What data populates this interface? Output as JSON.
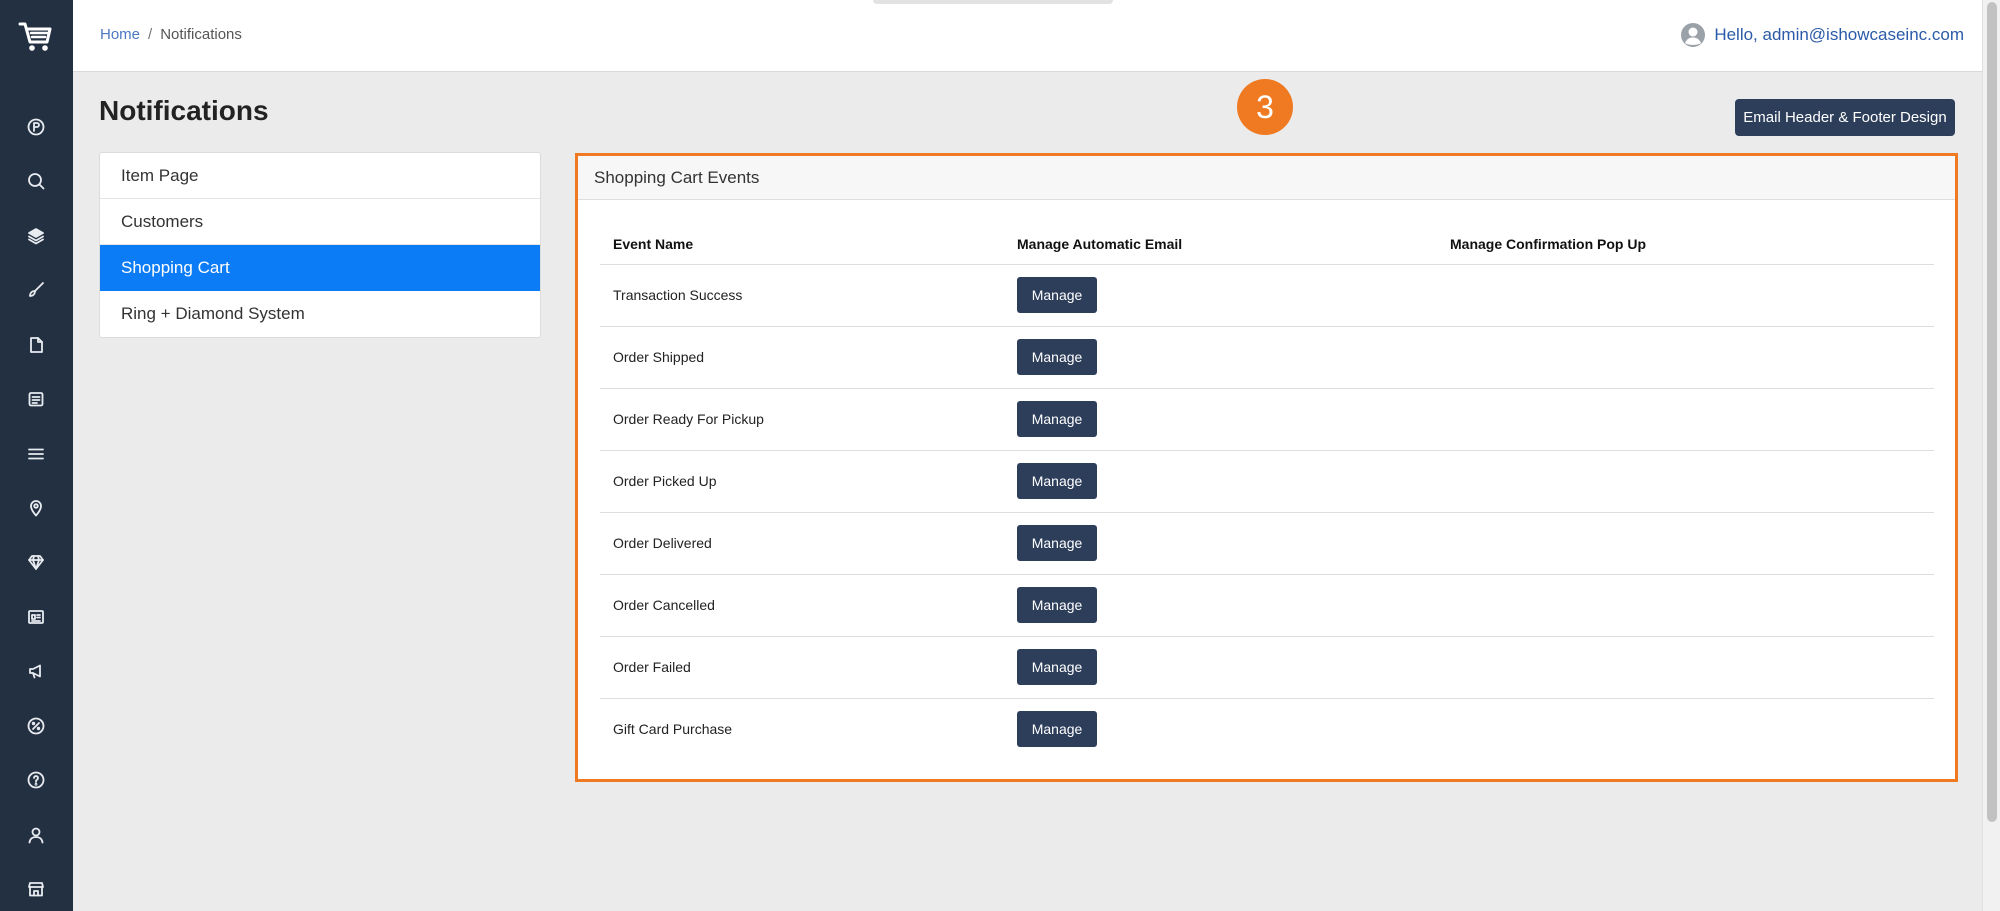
{
  "breadcrumb": {
    "home": "Home",
    "separator": "/",
    "current": "Notifications"
  },
  "user": {
    "greeting": "Hello, admin@ishowcaseinc.com",
    "icon": "user-circle-icon"
  },
  "page": {
    "title": "Notifications"
  },
  "step_badge": "3",
  "header_footer_button": "Email Header & Footer Design",
  "categories": [
    {
      "label": "Item Page",
      "active": false
    },
    {
      "label": "Customers",
      "active": false
    },
    {
      "label": "Shopping Cart",
      "active": true
    },
    {
      "label": "Ring + Diamond System",
      "active": false
    }
  ],
  "panel": {
    "title": "Shopping Cart Events",
    "columns": [
      "Event Name",
      "Manage Automatic Email",
      "Manage Confirmation Pop Up"
    ],
    "rows": [
      {
        "event": "Transaction Success",
        "email_action": "Manage",
        "popup_action": ""
      },
      {
        "event": "Order Shipped",
        "email_action": "Manage",
        "popup_action": ""
      },
      {
        "event": "Order Ready For Pickup",
        "email_action": "Manage",
        "popup_action": ""
      },
      {
        "event": "Order Picked Up",
        "email_action": "Manage",
        "popup_action": ""
      },
      {
        "event": "Order Delivered",
        "email_action": "Manage",
        "popup_action": ""
      },
      {
        "event": "Order Cancelled",
        "email_action": "Manage",
        "popup_action": ""
      },
      {
        "event": "Order Failed",
        "email_action": "Manage",
        "popup_action": ""
      },
      {
        "event": "Gift Card Purchase",
        "email_action": "Manage",
        "popup_action": ""
      }
    ]
  },
  "sidebar_icons": [
    "cart-logo-icon",
    "p-circle-icon",
    "seo-search-icon",
    "layers-icon",
    "brush-icon",
    "file-icon",
    "blog-icon",
    "menu-icon",
    "map-pin-icon",
    "diamond-icon",
    "gallery-icon",
    "megaphone-icon",
    "discount-icon",
    "help-icon",
    "user-icon",
    "store-icon"
  ],
  "colors": {
    "sidebar": "#233041",
    "accent": "#0b7cf5",
    "button": "#2d3e5b",
    "highlight": "#ef7a22",
    "link": "#2b5ba8"
  }
}
